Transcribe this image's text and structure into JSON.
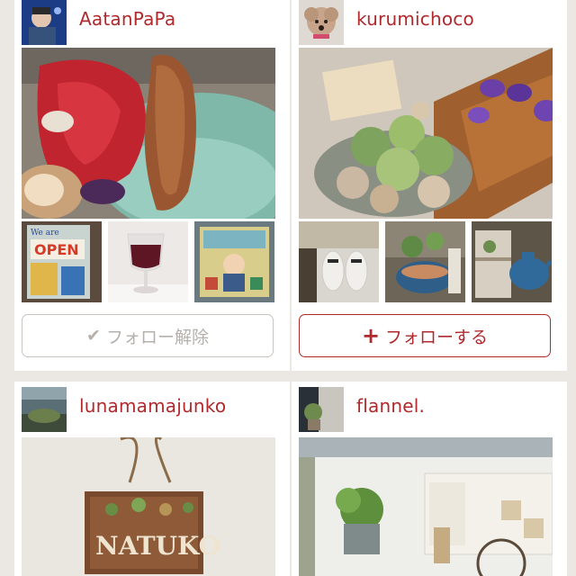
{
  "cards": [
    {
      "username": "AatanPaPa",
      "button_label": "フォロー解除",
      "button_icon": "check-icon",
      "button_state": "following"
    },
    {
      "username": "kurumichoco",
      "button_label": "フォローする",
      "button_icon": "plus-icon",
      "button_state": "not-following"
    },
    {
      "username": "lunamamajunko"
    },
    {
      "username": "flannel."
    }
  ],
  "photo_texts": {
    "sign": "NATUKO",
    "open_sign": "OPEN"
  },
  "colors": {
    "background": "#ebe7e2",
    "card": "#ffffff",
    "accent": "#b0292c",
    "muted": "#b5b0ab"
  }
}
